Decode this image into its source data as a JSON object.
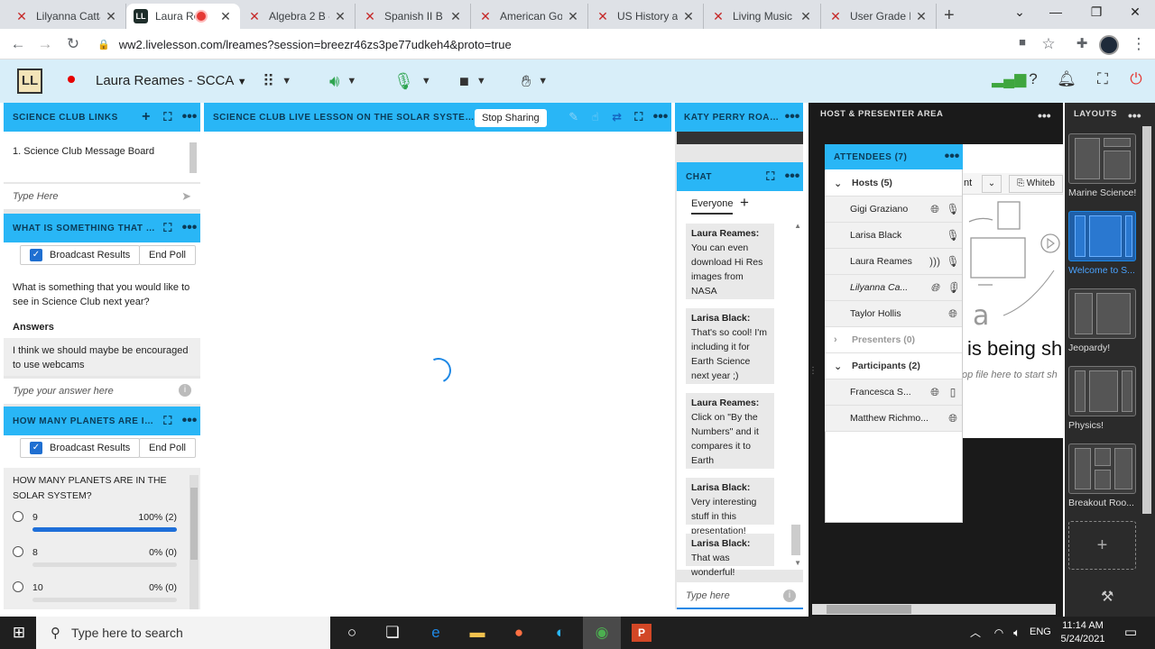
{
  "browser": {
    "tabs": [
      {
        "label": "Lilyanna Catta",
        "active": false
      },
      {
        "label": "Laura Rea",
        "active": true
      },
      {
        "label": "Algebra 2 B -",
        "active": false
      },
      {
        "label": "Spanish II B -",
        "active": false
      },
      {
        "label": "American Gov",
        "active": false
      },
      {
        "label": "US History ar",
        "active": false
      },
      {
        "label": "Living Music |",
        "active": false
      },
      {
        "label": "User Grade B",
        "active": false
      }
    ],
    "url": "ww2.livelesson.com/lreames?session=breezr46zs3pe77udkeh4&proto=true"
  },
  "app": {
    "logo": "LL",
    "session_name": "Laura Reames - SCCA"
  },
  "links_panel": {
    "title": "SCIENCE CLUB LINKS",
    "items": [
      "1. Science Club Message Board"
    ],
    "input_placeholder": "Type Here"
  },
  "poll1": {
    "title": "WHAT IS SOMETHING THAT Y...",
    "broadcast_label": "Broadcast Results",
    "end_poll_label": "End Poll",
    "question": "What is something that you would like to see in Science Club next year?",
    "answers_label": "Answers",
    "answer": "I think we should maybe be encouraged to use webcams",
    "input_placeholder": "Type your answer here"
  },
  "poll2": {
    "title": "HOW MANY PLANETS ARE IN ...",
    "broadcast_label": "Broadcast Results",
    "end_poll_label": "End Poll",
    "question": "HOW MANY PLANETS ARE IN THE SOLAR SYSTEM?",
    "options": [
      {
        "label": "9",
        "result": "100% (2)",
        "fraction": 1.0
      },
      {
        "label": "8",
        "result": "0% (0)",
        "fraction": 0.0
      },
      {
        "label": "10",
        "result": "0% (0)",
        "fraction": 0.0
      }
    ]
  },
  "presentation": {
    "title": "SCIENCE CLUB LIVE LESSON ON THE SOLAR SYSTEM.PPT...",
    "stop_sharing_label": "Stop Sharing"
  },
  "video_panel": {
    "title": "KATY PERRY ROAR ..."
  },
  "chat": {
    "title": "CHAT",
    "audience": "Everyone",
    "messages": [
      {
        "author": "Laura Reames:",
        "text": "You can even download Hi Res images from NASA"
      },
      {
        "author": "Larisa Black:",
        "text": "That's so cool! I'm including it for Earth Science next year ;)"
      },
      {
        "author": "Laura Reames:",
        "text": "Click on \"By the Numbers\" and it compares it to Earth"
      },
      {
        "author": "Larisa Black:",
        "text": "Very interesting stuff in this presentation!"
      },
      {
        "author": "Larisa Black:",
        "text": "That was wonderful!"
      }
    ],
    "input_placeholder": "Type here"
  },
  "host_area": {
    "title": "HOST & PRESENTER AREA",
    "behind_text_1": "is being sh",
    "behind_text_2": "op file here to start sh",
    "behind_tab_1": "nt",
    "behind_tab_2": "Whiteb"
  },
  "attendees": {
    "title": "ATTENDEES  (7)",
    "hosts_label": "Hosts (5)",
    "hosts": [
      "Gigi Graziano",
      "Larisa Black",
      "Laura Reames",
      "Lilyanna Ca...",
      "Taylor Hollis"
    ],
    "presenters_label": "Presenters (0)",
    "participants_label": "Participants (2)",
    "participants": [
      "Francesca S...",
      "Matthew Richmo..."
    ]
  },
  "layouts": {
    "title": "LAYOUTS",
    "items": [
      "Marine Science!",
      "Welcome to S...",
      "Jeopardy!",
      "Physics!",
      "Breakout Roo..."
    ]
  },
  "taskbar": {
    "search_placeholder": "Type here to search",
    "language": "ENG",
    "time": "11:14 AM",
    "date": "5/24/2021"
  }
}
